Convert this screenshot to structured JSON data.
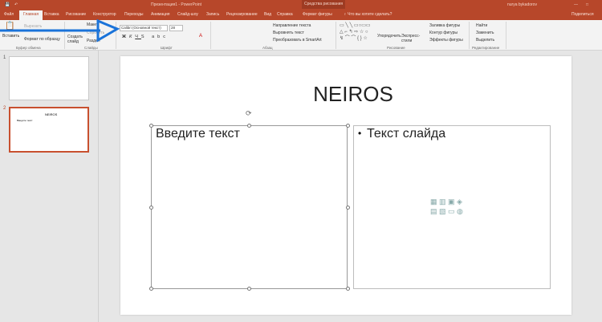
{
  "titlebar": {
    "title": "Презентация1 - PowerPoint",
    "context": "Средства рисования",
    "user": "nurya bykadorov"
  },
  "tabs": [
    "Файл",
    "Главная",
    "Вставка",
    "Рисование",
    "Конструктор",
    "Переходы",
    "Анимация",
    "Слайд-шоу",
    "Запись",
    "Рецензирование",
    "Вид",
    "Справка",
    "Формат фигуры"
  ],
  "tellme": "Что вы хотите сделать?",
  "share": "Поделиться",
  "ribbon": {
    "clipboard": {
      "paste": "Вставить",
      "cut": "Вырезать",
      "format": "Формат по образцу",
      "label": "Буфер обмена"
    },
    "slides": {
      "new": "Создать слайд",
      "layout": "Макет",
      "reset": "Сбросить",
      "section": "Раздел",
      "label": "Слайды"
    },
    "font": {
      "name": "Calibri (Основной текст)",
      "size": "28",
      "label": "Шрифт"
    },
    "paragraph": {
      "dir": "Направление текста",
      "align": "Выровнять текст",
      "smartart": "Преобразовать в SmartArt",
      "label": "Абзац"
    },
    "drawing": {
      "arrange": "Упорядочить",
      "styles": "Экспресс-стили",
      "fill": "Заливка фигуры",
      "outline": "Контур фигуры",
      "effects": "Эффекты фигуры",
      "label": "Рисование"
    },
    "editing": {
      "find": "Найти",
      "replace": "Заменить",
      "select": "Выделить",
      "label": "Редактирование"
    }
  },
  "thumbs": [
    {
      "num": "1"
    },
    {
      "num": "2",
      "title": "NEIROS",
      "text": "Введите текст"
    }
  ],
  "slide": {
    "title": "NEIROS",
    "left": "Введите текст",
    "right": "Текст слайда"
  },
  "colors": {
    "accent": "#b7472a",
    "arrow": "#1a73d9"
  }
}
